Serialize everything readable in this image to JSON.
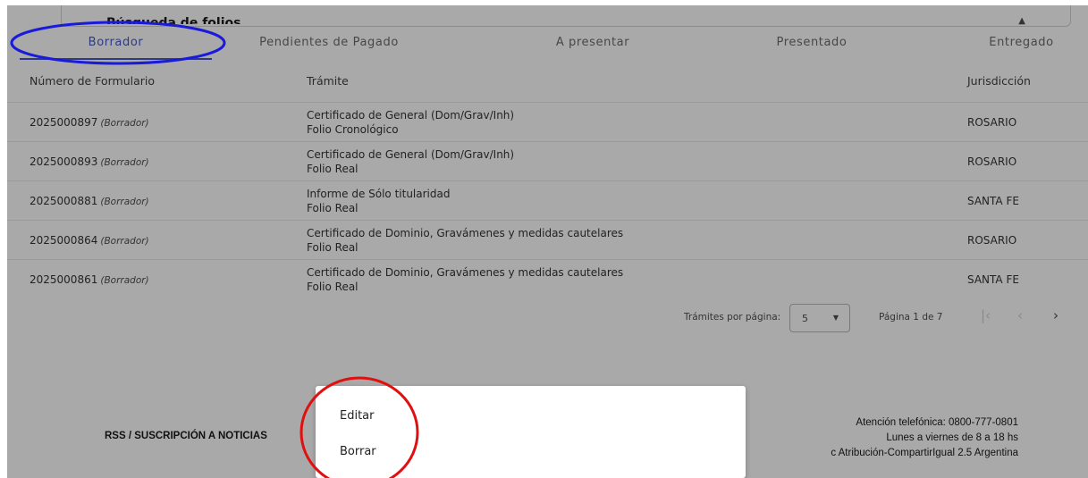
{
  "search": {
    "title": "Búsqueda de folios"
  },
  "tabs": [
    {
      "label": "Borrador"
    },
    {
      "label": "Pendientes de Pagado"
    },
    {
      "label": "A presentar"
    },
    {
      "label": "Presentado"
    },
    {
      "label": "Entregado"
    }
  ],
  "table": {
    "headers": {
      "numero": "Número de Formulario",
      "tramite": "Trámite",
      "jurisdiccion": "Jurisdicción"
    },
    "rows": [
      {
        "numero": "2025000897",
        "estado": "(Borrador)",
        "tramite": "Certificado de General (Dom/Grav/Inh)",
        "tipo": "Folio Cronológico",
        "jurisdiccion": "ROSARIO"
      },
      {
        "numero": "2025000893",
        "estado": "(Borrador)",
        "tramite": "Certificado de General (Dom/Grav/Inh)",
        "tipo": "Folio Real",
        "jurisdiccion": "ROSARIO"
      },
      {
        "numero": "2025000881",
        "estado": "(Borrador)",
        "tramite": "Informe de Sólo titularidad",
        "tipo": "Folio Real",
        "jurisdiccion": "SANTA FE"
      },
      {
        "numero": "2025000864",
        "estado": "(Borrador)",
        "tramite": "Certificado de Dominio, Gravámenes y medidas cautelares",
        "tipo": "Folio Real",
        "jurisdiccion": "ROSARIO"
      },
      {
        "numero": "2025000861",
        "estado": "(Borrador)",
        "tramite": "Certificado de Dominio, Gravámenes y medidas cautelares",
        "tipo": "Folio Real",
        "jurisdiccion": "SANTA FE"
      }
    ]
  },
  "pagination": {
    "per_page_label": "Trámites por página:",
    "per_page_value": "5",
    "page_label": "Página 1 de 7"
  },
  "footer": {
    "rss": "RSS / SUSCRIPCIÓN A NOTICIAS",
    "phone": "Atención telefónica: 0800-777-0801",
    "hours": "Lunes a viernes de 8 a 18 hs",
    "license": "c Atribución-CompartirIgual 2.5 Argentina"
  },
  "context_menu": {
    "edit": "Editar",
    "delete": "Borrar"
  },
  "colors": {
    "overlay": "#a9a9a9",
    "active_tab": "#2e3b82",
    "annotation_blue": "#1a1adb",
    "annotation_red": "#e01010"
  }
}
